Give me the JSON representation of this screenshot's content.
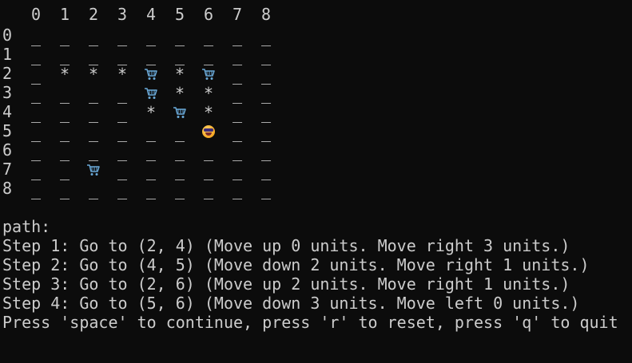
{
  "grid": {
    "column_labels": [
      "0",
      "1",
      "2",
      "3",
      "4",
      "5",
      "6",
      "7",
      "8"
    ],
    "rows": [
      {
        "label": "0",
        "cells": [
          "_",
          "_",
          "_",
          "_",
          "_",
          "_",
          "_",
          "_",
          "_"
        ]
      },
      {
        "label": "1",
        "cells": [
          "_",
          "_",
          "_",
          "_",
          "_",
          "_",
          "_",
          "_",
          "_"
        ]
      },
      {
        "label": "2",
        "cells": [
          "_",
          "*",
          "*",
          "*",
          "cart",
          "*",
          "cart",
          "_",
          "_"
        ]
      },
      {
        "label": "3",
        "cells": [
          "_",
          "_",
          "_",
          "_",
          "cart",
          "*",
          "*",
          "_",
          "_"
        ]
      },
      {
        "label": "4",
        "cells": [
          "_",
          "_",
          "_",
          "_",
          "*",
          "cart",
          "*",
          "_",
          "_"
        ]
      },
      {
        "label": "5",
        "cells": [
          "_",
          "_",
          "_",
          "_",
          "_",
          "_",
          "face",
          "_",
          "_"
        ]
      },
      {
        "label": "6",
        "cells": [
          "_",
          "_",
          "_",
          "_",
          "_",
          "_",
          "_",
          "_",
          "_"
        ]
      },
      {
        "label": "7",
        "cells": [
          "_",
          "_",
          "cart",
          "_",
          "_",
          "_",
          "_",
          "_",
          "_"
        ]
      },
      {
        "label": "8",
        "cells": [
          "_",
          "_",
          "_",
          "_",
          "_",
          "_",
          "_",
          "_",
          "_"
        ]
      }
    ],
    "icon_names": {
      "cart": "shopping-cart-icon",
      "face": "grinning-face-icon"
    }
  },
  "output": {
    "path_label": "path:",
    "steps": [
      "Step 1: Go to (2, 4) (Move up 0 units. Move right 3 units.)",
      "Step 2: Go to (4, 5) (Move down 2 units. Move right 1 units.)",
      "Step 3: Go to (2, 6) (Move up 2 units. Move right 1 units.)",
      "Step 4: Go to (5, 6) (Move down 3 units. Move left 0 units.)"
    ],
    "prompt": "Press 'space' to continue, press 'r' to reset, press 'q' to quit"
  },
  "colors": {
    "background": "#0c0c0c",
    "text": "#cccccc",
    "cart": "#6aa9d8"
  }
}
